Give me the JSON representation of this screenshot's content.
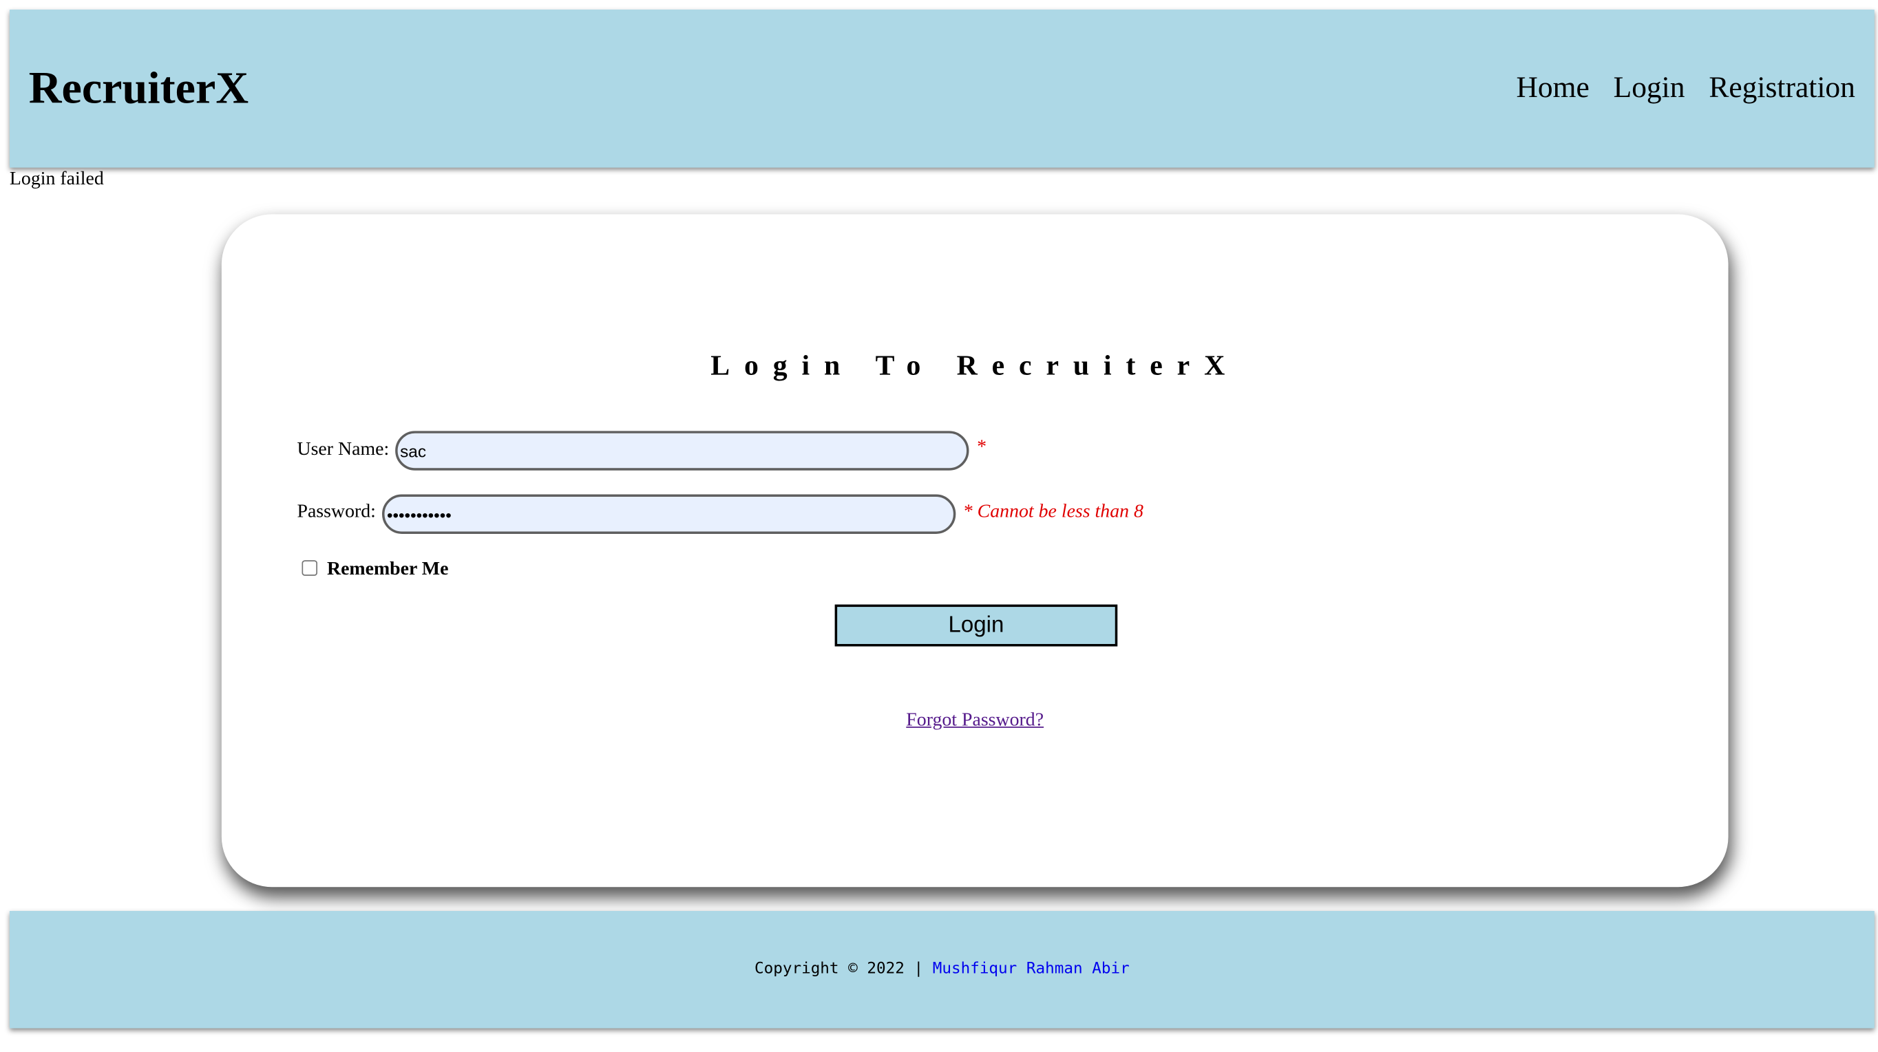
{
  "header": {
    "brand": "RecruiterX",
    "nav": [
      "Home",
      "Login",
      "Registration"
    ],
    "background": "#add8e6"
  },
  "status_message": "Login failed",
  "login_form": {
    "title": "Login To RecruiterX",
    "username_label": "User Name:",
    "username_value": "sac",
    "username_required_mark": "*",
    "password_label": "Password:",
    "password_value": "•••••••••••",
    "password_error": "* Cannot be less than 8",
    "remember_label": "Remember Me",
    "remember_checked": false,
    "submit_label": "Login",
    "forgot_link": "Forgot Password?"
  },
  "footer": {
    "copyright": "Copyright © 2022 |",
    "author": "Mushfiqur Rahman Abir"
  },
  "colors": {
    "accent": "#add8e6",
    "error": "#e00000",
    "link_visited": "#551a8b",
    "link": "#0000ee"
  }
}
